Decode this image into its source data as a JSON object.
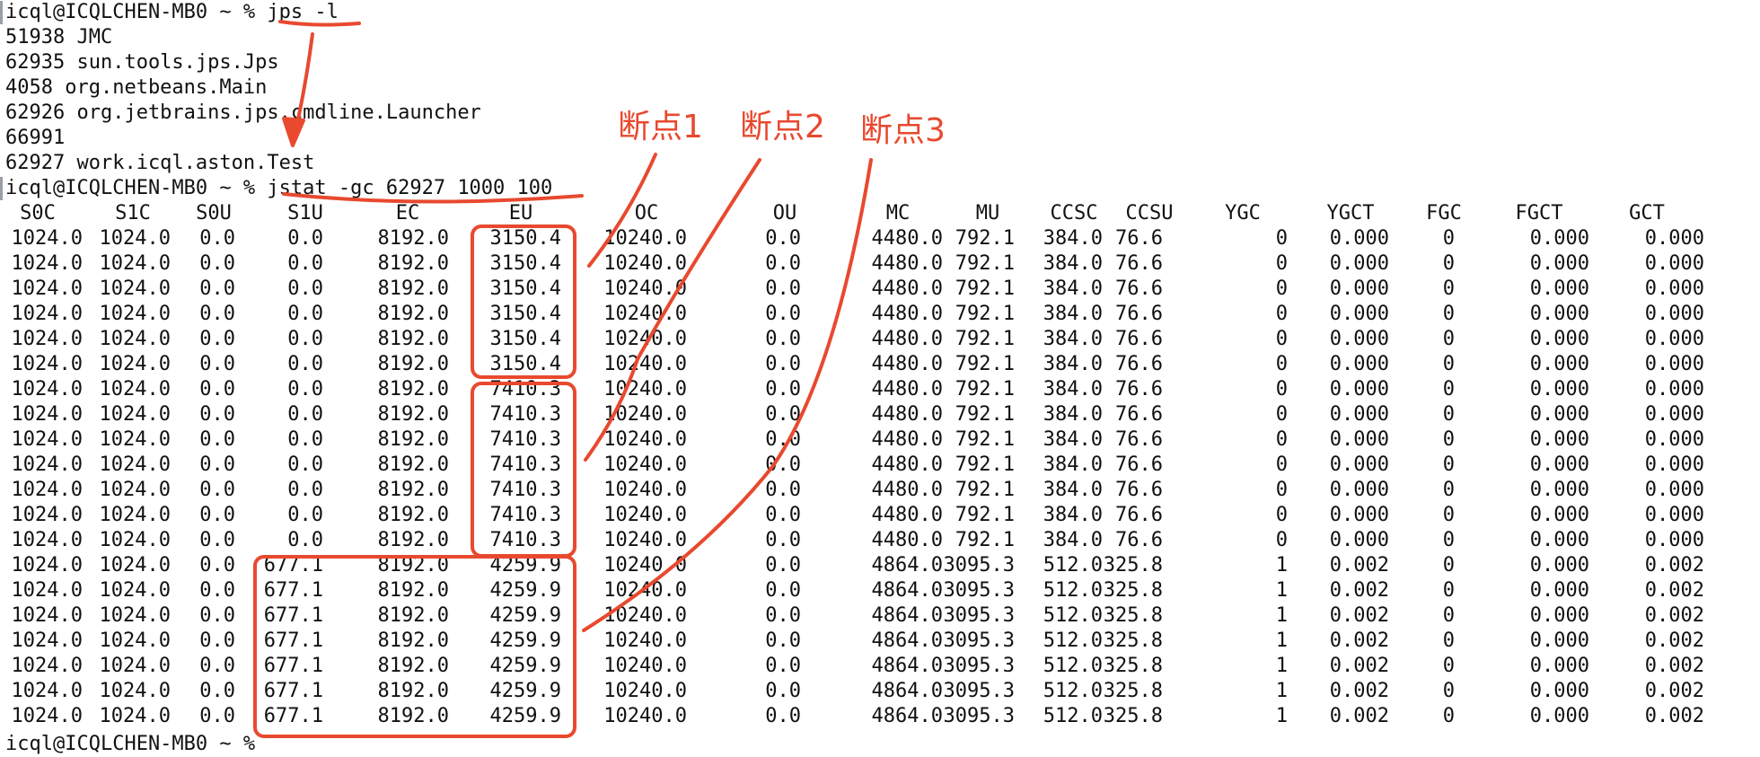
{
  "terminal": {
    "lines": [
      "icql@ICQLCHEN-MB0 ~ % jps -l",
      "51938 JMC",
      "62935 sun.tools.jps.Jps",
      "4058 org.netbeans.Main",
      "62926 org.jetbrains.jps.cmdline.Launcher",
      "66991",
      "62927 work.icql.aston.Test",
      "icql@ICQLCHEN-MB0 ~ % jstat -gc 62927 1000 100"
    ],
    "last_line_partial": "icql@ICQLCHEN-MB0 ~ % "
  },
  "jstat": {
    "headers": [
      "S0C",
      "S1C",
      "S0U",
      "S1U",
      "EC",
      "EU",
      "OC",
      "OU",
      "MC",
      "MU",
      "CCSC",
      "CCSU",
      "YGC",
      "YGCT",
      "FGC",
      "FGCT",
      "GCT"
    ],
    "rows": [
      [
        "1024.0",
        "1024.0",
        "0.0",
        "0.0",
        "8192.0",
        "3150.4",
        "10240.0",
        "0.0",
        "4480.0",
        "792.1",
        "384.0",
        "76.6",
        "0",
        "0.000",
        "0",
        "0.000",
        "0.000"
      ],
      [
        "1024.0",
        "1024.0",
        "0.0",
        "0.0",
        "8192.0",
        "3150.4",
        "10240.0",
        "0.0",
        "4480.0",
        "792.1",
        "384.0",
        "76.6",
        "0",
        "0.000",
        "0",
        "0.000",
        "0.000"
      ],
      [
        "1024.0",
        "1024.0",
        "0.0",
        "0.0",
        "8192.0",
        "3150.4",
        "10240.0",
        "0.0",
        "4480.0",
        "792.1",
        "384.0",
        "76.6",
        "0",
        "0.000",
        "0",
        "0.000",
        "0.000"
      ],
      [
        "1024.0",
        "1024.0",
        "0.0",
        "0.0",
        "8192.0",
        "3150.4",
        "10240.0",
        "0.0",
        "4480.0",
        "792.1",
        "384.0",
        "76.6",
        "0",
        "0.000",
        "0",
        "0.000",
        "0.000"
      ],
      [
        "1024.0",
        "1024.0",
        "0.0",
        "0.0",
        "8192.0",
        "3150.4",
        "10240.0",
        "0.0",
        "4480.0",
        "792.1",
        "384.0",
        "76.6",
        "0",
        "0.000",
        "0",
        "0.000",
        "0.000"
      ],
      [
        "1024.0",
        "1024.0",
        "0.0",
        "0.0",
        "8192.0",
        "3150.4",
        "10240.0",
        "0.0",
        "4480.0",
        "792.1",
        "384.0",
        "76.6",
        "0",
        "0.000",
        "0",
        "0.000",
        "0.000"
      ],
      [
        "1024.0",
        "1024.0",
        "0.0",
        "0.0",
        "8192.0",
        "7410.3",
        "10240.0",
        "0.0",
        "4480.0",
        "792.1",
        "384.0",
        "76.6",
        "0",
        "0.000",
        "0",
        "0.000",
        "0.000"
      ],
      [
        "1024.0",
        "1024.0",
        "0.0",
        "0.0",
        "8192.0",
        "7410.3",
        "10240.0",
        "0.0",
        "4480.0",
        "792.1",
        "384.0",
        "76.6",
        "0",
        "0.000",
        "0",
        "0.000",
        "0.000"
      ],
      [
        "1024.0",
        "1024.0",
        "0.0",
        "0.0",
        "8192.0",
        "7410.3",
        "10240.0",
        "0.0",
        "4480.0",
        "792.1",
        "384.0",
        "76.6",
        "0",
        "0.000",
        "0",
        "0.000",
        "0.000"
      ],
      [
        "1024.0",
        "1024.0",
        "0.0",
        "0.0",
        "8192.0",
        "7410.3",
        "10240.0",
        "0.0",
        "4480.0",
        "792.1",
        "384.0",
        "76.6",
        "0",
        "0.000",
        "0",
        "0.000",
        "0.000"
      ],
      [
        "1024.0",
        "1024.0",
        "0.0",
        "0.0",
        "8192.0",
        "7410.3",
        "10240.0",
        "0.0",
        "4480.0",
        "792.1",
        "384.0",
        "76.6",
        "0",
        "0.000",
        "0",
        "0.000",
        "0.000"
      ],
      [
        "1024.0",
        "1024.0",
        "0.0",
        "0.0",
        "8192.0",
        "7410.3",
        "10240.0",
        "0.0",
        "4480.0",
        "792.1",
        "384.0",
        "76.6",
        "0",
        "0.000",
        "0",
        "0.000",
        "0.000"
      ],
      [
        "1024.0",
        "1024.0",
        "0.0",
        "0.0",
        "8192.0",
        "7410.3",
        "10240.0",
        "0.0",
        "4480.0",
        "792.1",
        "384.0",
        "76.6",
        "0",
        "0.000",
        "0",
        "0.000",
        "0.000"
      ],
      [
        "1024.0",
        "1024.0",
        "0.0",
        "677.1",
        "8192.0",
        "4259.9",
        "10240.0",
        "0.0",
        "4864.0",
        "3095.3",
        "512.0",
        "325.8",
        "1",
        "0.002",
        "0",
        "0.000",
        "0.002"
      ],
      [
        "1024.0",
        "1024.0",
        "0.0",
        "677.1",
        "8192.0",
        "4259.9",
        "10240.0",
        "0.0",
        "4864.0",
        "3095.3",
        "512.0",
        "325.8",
        "1",
        "0.002",
        "0",
        "0.000",
        "0.002"
      ],
      [
        "1024.0",
        "1024.0",
        "0.0",
        "677.1",
        "8192.0",
        "4259.9",
        "10240.0",
        "0.0",
        "4864.0",
        "3095.3",
        "512.0",
        "325.8",
        "1",
        "0.002",
        "0",
        "0.000",
        "0.002"
      ],
      [
        "1024.0",
        "1024.0",
        "0.0",
        "677.1",
        "8192.0",
        "4259.9",
        "10240.0",
        "0.0",
        "4864.0",
        "3095.3",
        "512.0",
        "325.8",
        "1",
        "0.002",
        "0",
        "0.000",
        "0.002"
      ],
      [
        "1024.0",
        "1024.0",
        "0.0",
        "677.1",
        "8192.0",
        "4259.9",
        "10240.0",
        "0.0",
        "4864.0",
        "3095.3",
        "512.0",
        "325.8",
        "1",
        "0.002",
        "0",
        "0.000",
        "0.002"
      ],
      [
        "1024.0",
        "1024.0",
        "0.0",
        "677.1",
        "8192.0",
        "4259.9",
        "10240.0",
        "0.0",
        "4864.0",
        "3095.3",
        "512.0",
        "325.8",
        "1",
        "0.002",
        "0",
        "0.000",
        "0.002"
      ],
      [
        "1024.0",
        "1024.0",
        "0.0",
        "677.1",
        "8192.0",
        "4259.9",
        "10240.0",
        "0.0",
        "4864.0",
        "3095.3",
        "512.0",
        "325.8",
        "1",
        "0.002",
        "0",
        "0.000",
        "0.002"
      ]
    ]
  },
  "annotations": {
    "color": "#e8492f",
    "breakpoint_labels": [
      "断点1",
      "断点2",
      "断点3"
    ]
  }
}
